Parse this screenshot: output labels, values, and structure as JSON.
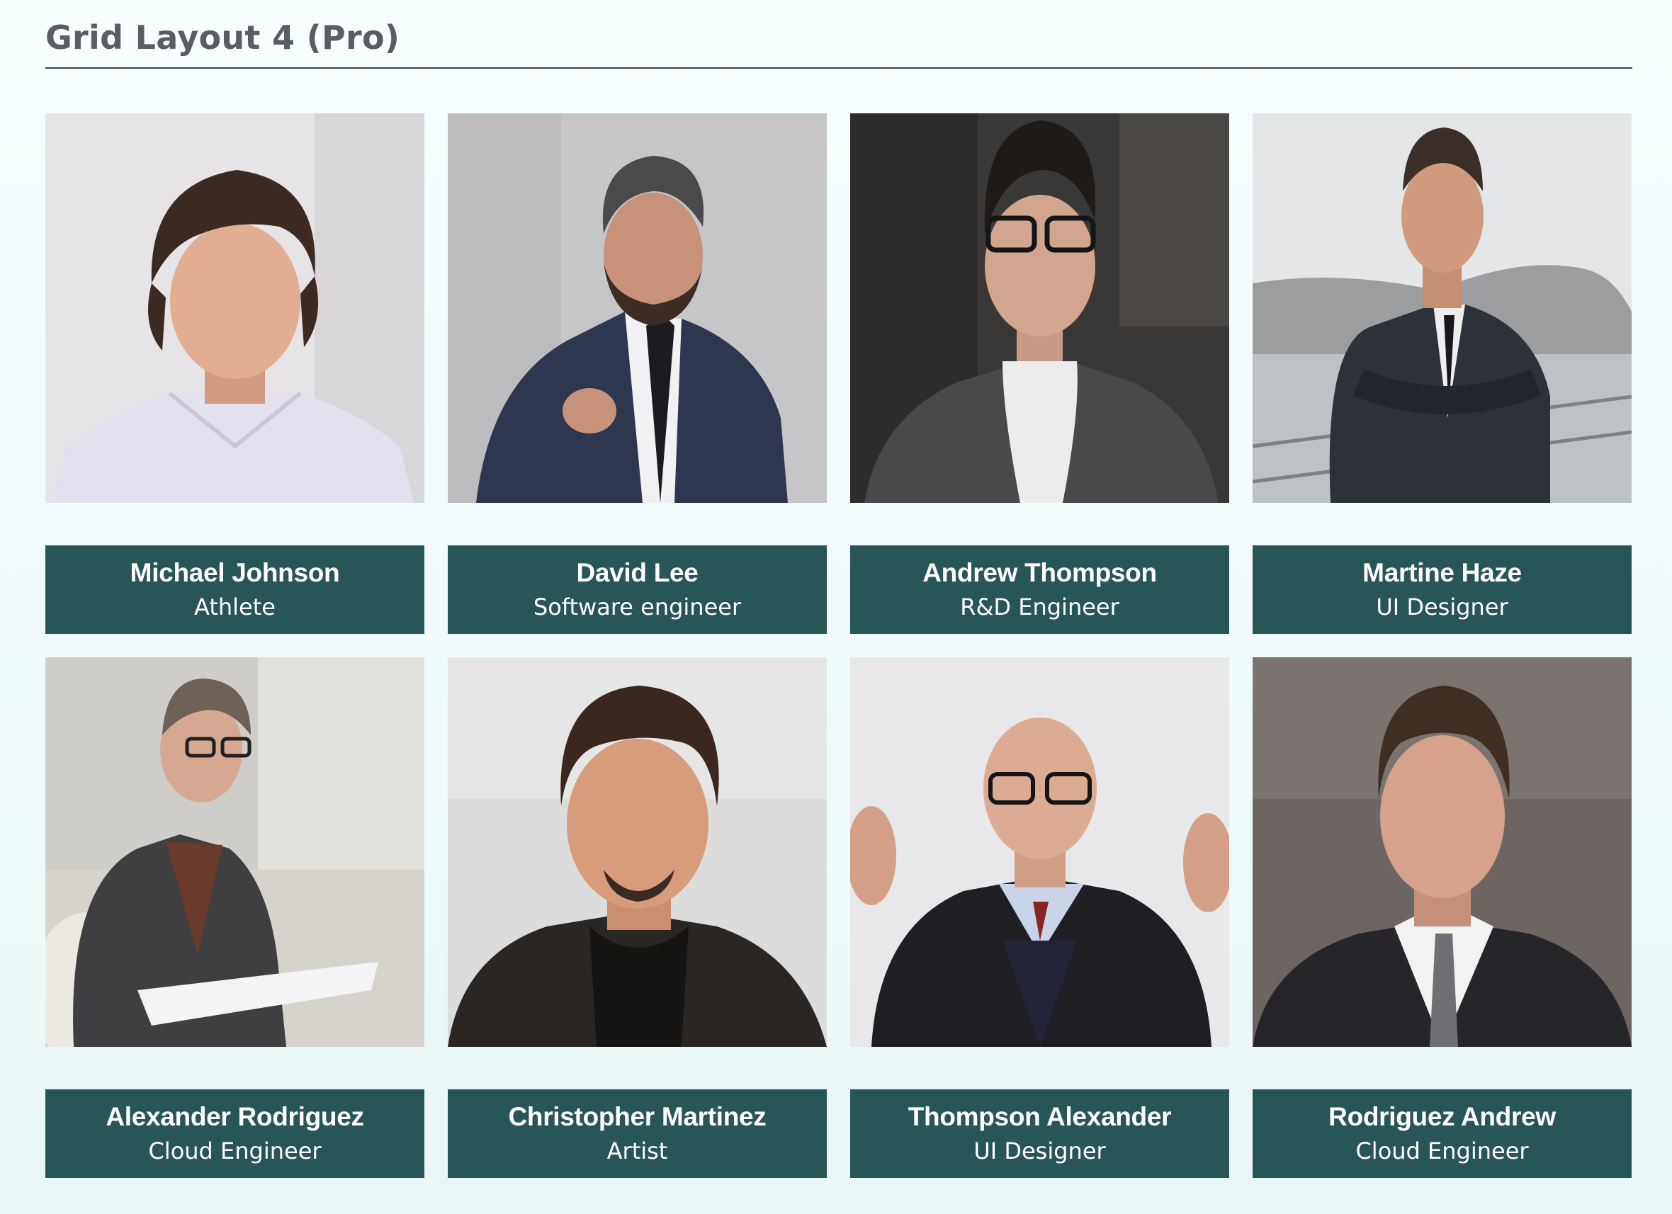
{
  "page": {
    "title": "Grid Layout 4 (Pro)"
  },
  "team": [
    {
      "name": "Michael Johnson",
      "role": "Athlete",
      "photo_icon": "portrait-photo"
    },
    {
      "name": "David Lee",
      "role": "Software engineer",
      "photo_icon": "portrait-photo"
    },
    {
      "name": "Andrew Thompson",
      "role": "R&D Engineer",
      "photo_icon": "portrait-photo"
    },
    {
      "name": "Martine Haze",
      "role": "UI Designer",
      "photo_icon": "portrait-photo"
    },
    {
      "name": "Alexander Rodriguez",
      "role": "Cloud Engineer",
      "photo_icon": "portrait-photo"
    },
    {
      "name": "Christopher Martinez",
      "role": "Artist",
      "photo_icon": "portrait-photo"
    },
    {
      "name": "Thompson Alexander",
      "role": "UI Designer",
      "photo_icon": "portrait-photo"
    },
    {
      "name": "Rodriguez Andrew",
      "role": "Cloud Engineer",
      "photo_icon": "portrait-photo"
    }
  ],
  "colors": {
    "caption_background": "#285656",
    "caption_text": "#ffffff",
    "title_text": "#5a5d61",
    "page_background": "#f3fcfc"
  }
}
